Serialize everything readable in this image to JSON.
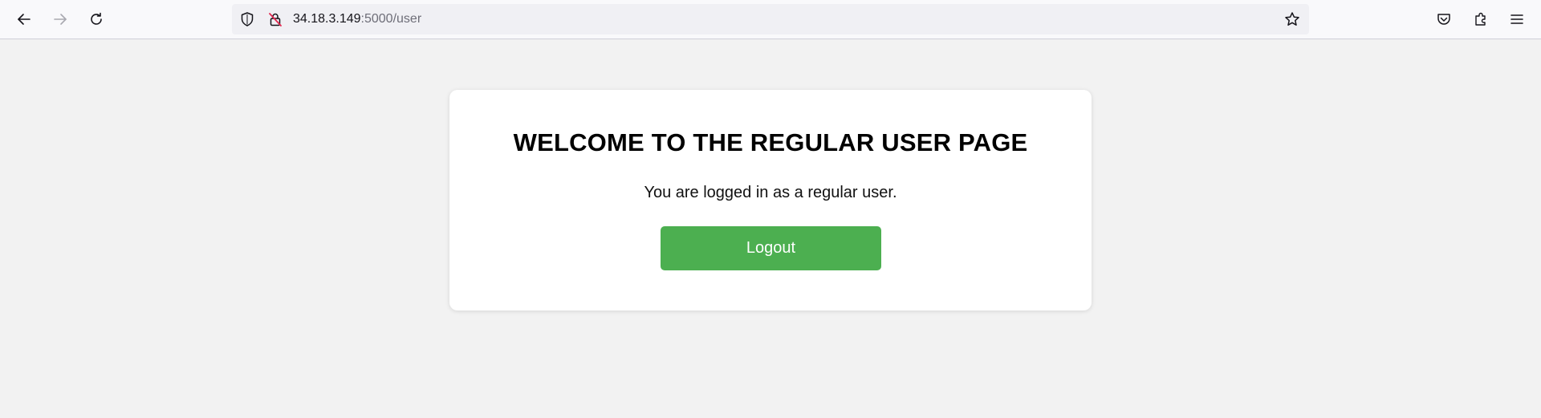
{
  "browser": {
    "url_host": "34.18.3.149",
    "url_path": ":5000/user",
    "icons": {
      "back": "back-arrow-icon",
      "forward": "forward-arrow-icon",
      "reload": "reload-icon",
      "shield": "shield-icon",
      "insecure": "insecure-lock-icon",
      "bookmark": "star-icon",
      "pocket": "pocket-icon",
      "extensions": "puzzle-icon",
      "menu": "hamburger-menu-icon"
    }
  },
  "page": {
    "heading": "WELCOME TO THE REGULAR USER PAGE",
    "message": "You are logged in as a regular user.",
    "logout_label": "Logout",
    "colors": {
      "background": "#f2f2f2",
      "card": "#ffffff",
      "button": "#4caf50",
      "button_text": "#ffffff"
    }
  }
}
